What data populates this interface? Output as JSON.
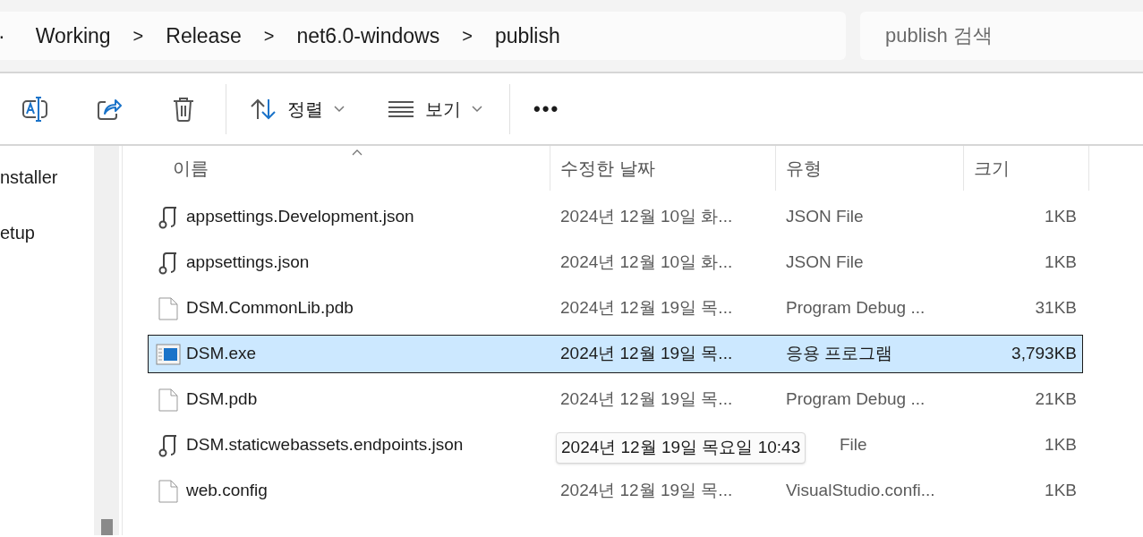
{
  "address_bar": {
    "crumbs": [
      "·",
      "Working",
      "Release",
      "net6.0-windows",
      "publish"
    ],
    "separator": ">"
  },
  "search": {
    "placeholder": "publish 검색"
  },
  "toolbar": {
    "sort_label": "정렬",
    "view_label": "보기",
    "more": "•••"
  },
  "sidebar": {
    "items": [
      {
        "label": "nstaller"
      },
      {
        "label": "etup"
      }
    ]
  },
  "table": {
    "columns": [
      "이름",
      "수정한 날짜",
      "유형",
      "크기"
    ],
    "rows": [
      {
        "kind": "json",
        "name": "appsettings.Development.json",
        "date": "2024년 12월 10일 화...",
        "type": "JSON File",
        "size": "1KB",
        "selected": false
      },
      {
        "kind": "json",
        "name": "appsettings.json",
        "date": "2024년 12월 10일 화...",
        "type": "JSON File",
        "size": "1KB",
        "selected": false
      },
      {
        "kind": "file",
        "name": "DSM.CommonLib.pdb",
        "date": "2024년 12월 19일 목...",
        "type": "Program Debug ...",
        "size": "31KB",
        "selected": false
      },
      {
        "kind": "exe",
        "name": "DSM.exe",
        "date": "2024년 12월 19일 목...",
        "type": "응용 프로그램",
        "size": "3,793KB",
        "selected": true
      },
      {
        "kind": "file",
        "name": "DSM.pdb",
        "date": "2024년 12월 19일 목...",
        "type": "Program Debug ...",
        "size": "21KB",
        "selected": false
      },
      {
        "kind": "json",
        "name": "DSM.staticwebassets.endpoints.json",
        "type": "File",
        "size": "1KB",
        "selected": false
      },
      {
        "kind": "file",
        "name": "web.config",
        "date": "2024년 12월 19일 목...",
        "type": "VisualStudio.confi...",
        "size": "1KB",
        "selected": false
      }
    ]
  },
  "tooltip": "2024년 12월 19일 목요일 10:43"
}
